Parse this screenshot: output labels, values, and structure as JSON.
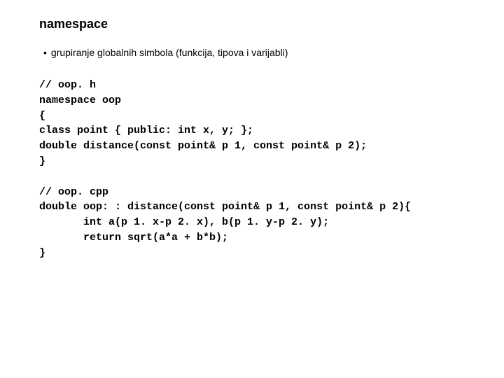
{
  "title": "namespace",
  "bullet": {
    "marker": "•",
    "text": "grupiranje globalnih simbola (funkcija, tipova i varijabli)"
  },
  "code1": "// oop. h\nnamespace oop\n{\nclass point { public: int x, y; };\ndouble distance(const point& p 1, const point& p 2);\n}",
  "code2": "// oop. cpp\ndouble oop: : distance(const point& p 1, const point& p 2){\n       int a(p 1. x-p 2. x), b(p 1. y-p 2. y);\n       return sqrt(a*a + b*b);\n}"
}
